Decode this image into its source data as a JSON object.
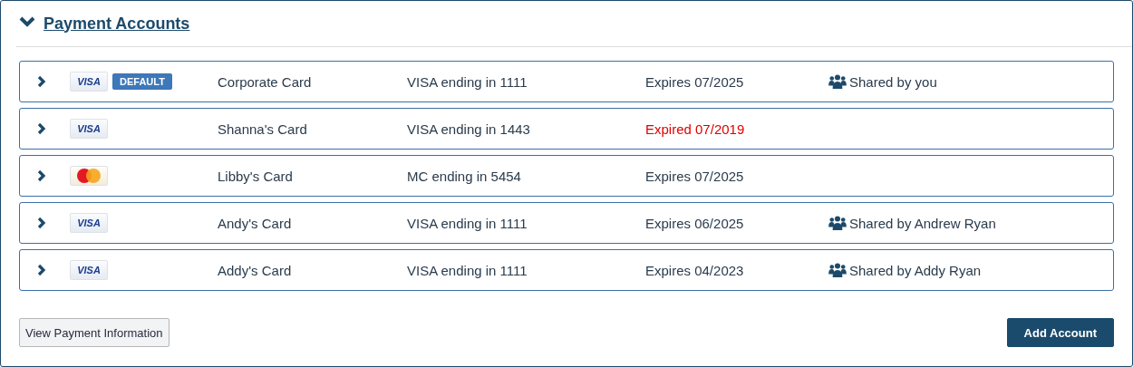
{
  "panel": {
    "title": "Payment Accounts",
    "expanded": true
  },
  "accounts": [
    {
      "card": {
        "kind": "visa",
        "text": "VISA"
      },
      "default_badge": "DEFAULT",
      "name": "Corporate Card",
      "number": "VISA ending in 1111",
      "expiry": "Expires 07/2025",
      "expired": false,
      "shared": "Shared by you"
    },
    {
      "card": {
        "kind": "visa",
        "text": "VISA"
      },
      "name": "Shanna's Card",
      "number": "VISA ending in 1443",
      "expiry": "Expired 07/2019",
      "expired": true
    },
    {
      "card": {
        "kind": "mastercard"
      },
      "name": "Libby's Card",
      "number": "MC ending in 5454",
      "expiry": "Expires 07/2025",
      "expired": false
    },
    {
      "card": {
        "kind": "visa",
        "text": "VISA"
      },
      "name": "Andy's Card",
      "number": "VISA ending in 1111",
      "expiry": "Expires 06/2025",
      "expired": false,
      "shared": "Shared by Andrew Ryan"
    },
    {
      "card": {
        "kind": "visa",
        "text": "VISA"
      },
      "name": "Addy's Card",
      "number": "VISA ending in 1111",
      "expiry": "Expires 04/2023",
      "expired": false,
      "shared": "Shared by Addy Ryan"
    }
  ],
  "buttons": {
    "secondary": "View Payment Information",
    "primary": "Add Account"
  }
}
